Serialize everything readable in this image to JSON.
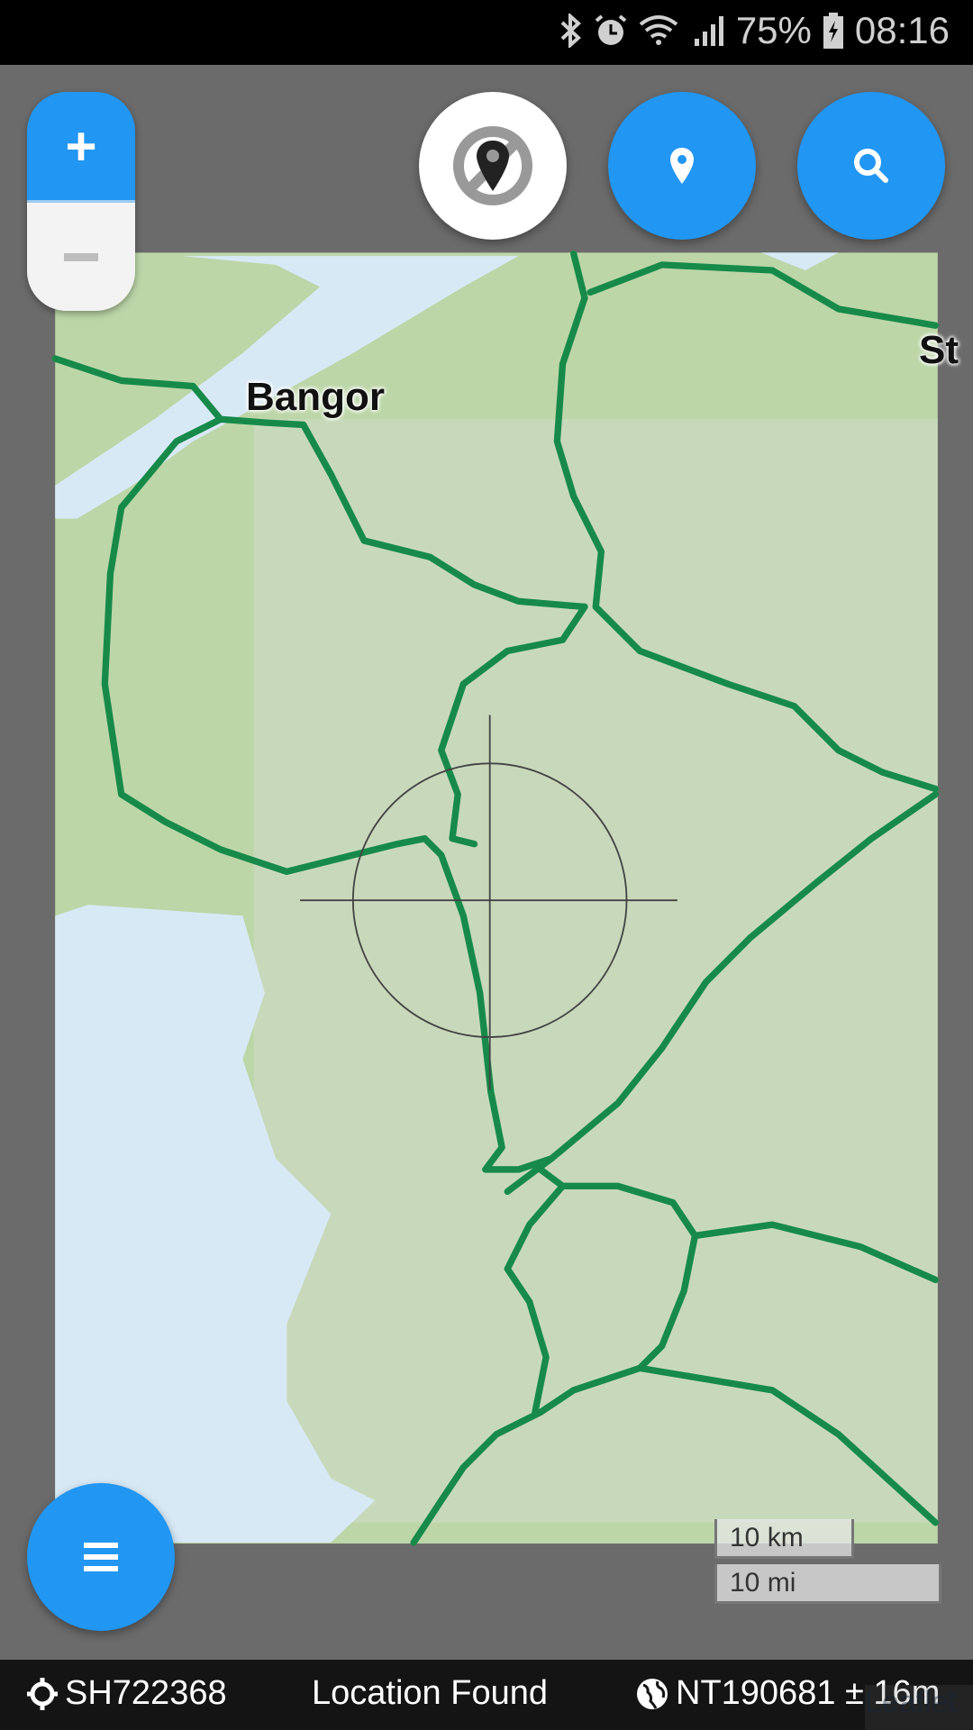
{
  "status_bar": {
    "battery": "75%",
    "time": "08:16",
    "icons": [
      "bluetooth-icon",
      "alarm-icon",
      "wifi-icon",
      "signal-icon",
      "battery-charging-icon"
    ]
  },
  "map": {
    "place_labels": [
      "Bangor",
      "St"
    ],
    "colors": {
      "land": "#bcd6a8",
      "water": "#d8e9f6",
      "road": "#178a4a",
      "frame": "#6b6b6b"
    }
  },
  "controls": {
    "zoom_in": "+",
    "zoom_out": "−",
    "buttons": [
      "location-off-icon",
      "map-pin-icon",
      "search-icon",
      "menu-icon"
    ],
    "accent": "#2196f3"
  },
  "scale": {
    "km": "10 km",
    "mi": "10 mi"
  },
  "bottom_bar": {
    "crosshair_ref": "SH722368",
    "status": "Location Found",
    "gps_ref": "NT190681 ± 16m"
  },
  "attribution": "Leaflet"
}
